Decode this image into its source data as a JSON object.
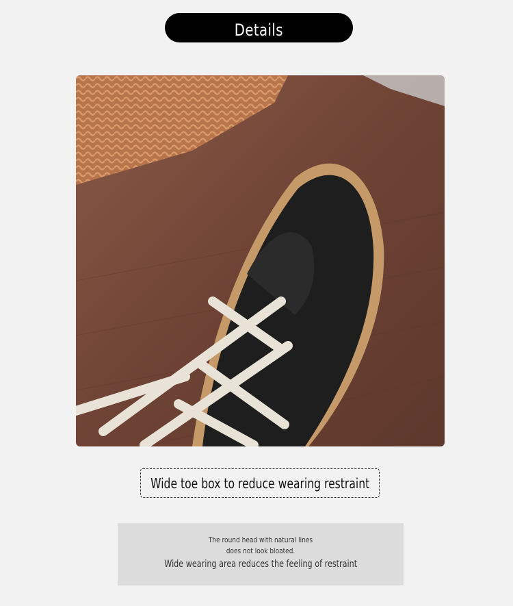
{
  "header": {
    "title": "Details"
  },
  "photo": {
    "subject": "shoe-photo"
  },
  "caption": {
    "text": "Wide toe box to reduce wearing restraint"
  },
  "description": {
    "line1": "The round head with natural lines does not look bloated.",
    "line2": "Wide wearing area reduces the feeling of restraint"
  },
  "colors": {
    "pill": "#000000",
    "background": "#f2f2f2",
    "desc_bg": "#dcdcdc"
  }
}
